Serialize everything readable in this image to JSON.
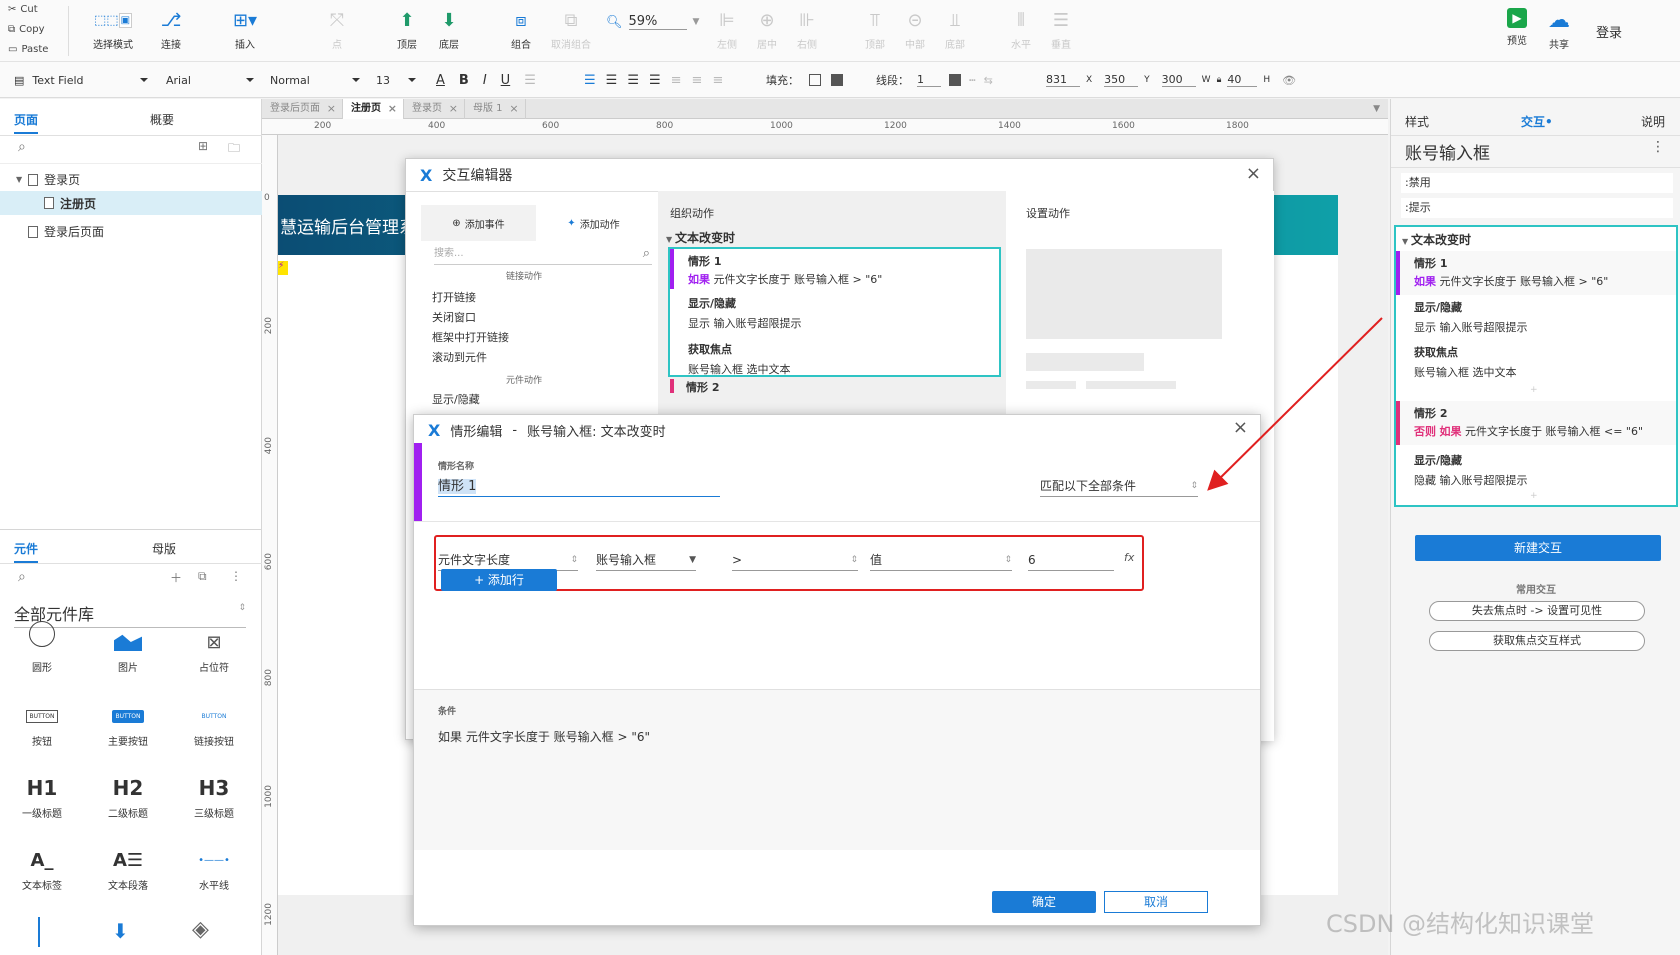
{
  "toolbar": {
    "clipboard": [
      "Cut",
      "Copy",
      "Paste"
    ],
    "tools": [
      {
        "label": "选择模式",
        "icon": "select-mode-icon"
      },
      {
        "label": "连接",
        "icon": "connect-icon"
      },
      {
        "label": "插入",
        "icon": "insert-icon"
      },
      {
        "label": "点",
        "icon": "point-icon"
      },
      {
        "label": "顶层",
        "icon": "bring-front-icon"
      },
      {
        "label": "底层",
        "icon": "send-back-icon"
      },
      {
        "label": "组合",
        "icon": "group-icon"
      },
      {
        "label": "取消组合",
        "icon": "ungroup-icon"
      },
      {
        "label": "左侧",
        "icon": "align-left-icon"
      },
      {
        "label": "居中",
        "icon": "align-center-icon"
      },
      {
        "label": "右侧",
        "icon": "align-right-icon"
      },
      {
        "label": "顶部",
        "icon": "align-top-icon"
      },
      {
        "label": "中部",
        "icon": "align-middle-icon"
      },
      {
        "label": "底部",
        "icon": "align-bottom-icon"
      },
      {
        "label": "水平",
        "icon": "distribute-h-icon"
      },
      {
        "label": "垂直",
        "icon": "distribute-v-icon"
      }
    ],
    "zoom": "59%",
    "preview": "预览",
    "share": "共享",
    "login": "登录"
  },
  "format_bar": {
    "widget_type": "Text Field",
    "font": "Arial",
    "style": "Normal",
    "size": "13",
    "fill_label": "填充：",
    "line_label": "线段：",
    "line_value": "1",
    "x": "831",
    "x_label": "X",
    "y": "350",
    "y_label": "Y",
    "w": "300",
    "w_label": "W",
    "h": "40",
    "h_label": "H"
  },
  "left_panel": {
    "tabs": [
      "页面",
      "概要"
    ],
    "pages": [
      "登录页",
      "注册页",
      "登录后页面"
    ],
    "lib_tabs": [
      "元件",
      "母版"
    ],
    "library": "全部元件库",
    "widgets": [
      {
        "label": "圆形"
      },
      {
        "label": "图片"
      },
      {
        "label": "占位符"
      },
      {
        "label": "按钮"
      },
      {
        "label": "主要按钮"
      },
      {
        "label": "链接按钮"
      },
      {
        "label": "一级标题"
      },
      {
        "label": "二级标题"
      },
      {
        "label": "三级标题"
      },
      {
        "label": "文本标签"
      },
      {
        "label": "文本段落"
      },
      {
        "label": "水平线"
      }
    ],
    "button_text": "BUTTON",
    "h1": "H1",
    "h2": "H2",
    "h3": "H3"
  },
  "page_tabs": [
    "登录后页面",
    "注册页",
    "登录页",
    "母版 1"
  ],
  "ruler_h": [
    "200",
    "400",
    "600",
    "800",
    "1000",
    "1200",
    "1400",
    "1600",
    "1800"
  ],
  "ruler_v": [
    "0",
    "200",
    "400",
    "600",
    "800",
    "1000",
    "1200"
  ],
  "canvas": {
    "banner": "慧运输后台管理系"
  },
  "right_panel": {
    "tabs": [
      "样式",
      "交互",
      "说明"
    ],
    "widget_name": "账号输入框",
    "props": [
      "禁用",
      "提示"
    ],
    "event": "文本改变时",
    "case1": {
      "title": "情形 1",
      "kw": "如果",
      "cond": "元件文字长度于 账号输入框 > \"6\""
    },
    "actions1": [
      {
        "title": "显示/隐藏",
        "detail": "显示 输入账号超限提示"
      },
      {
        "title": "获取焦点",
        "detail": "账号输入框 选中文本"
      }
    ],
    "case2": {
      "title": "情形 2",
      "kw1": "否则",
      "kw2": "如果",
      "cond": "元件文字长度于 账号输入框 <= \"6\""
    },
    "actions2": [
      {
        "title": "显示/隐藏",
        "detail": "隐藏 输入账号超限提示"
      }
    ],
    "new_interaction": "新建交互",
    "common": "常用交互",
    "common_items": [
      "失去焦点时 -> 设置可见性",
      "获取焦点交互样式"
    ]
  },
  "interaction_editor": {
    "title": "交互编辑器",
    "add_event": "添加事件",
    "add_action": "添加动作",
    "search_placeholder": "搜索...",
    "link_group": "链接动作",
    "link_actions": [
      "打开链接",
      "关闭窗口",
      "框架中打开链接",
      "滚动到元件"
    ],
    "widget_group": "元件动作",
    "widget_actions": [
      "显示/隐藏"
    ],
    "organize": "组织动作",
    "event": "文本改变时",
    "case1_title": "情形 1",
    "case1_kw": "如果",
    "case1_cond": "元件文字长度于 账号输入框 > \"6\"",
    "act1_title": "显示/隐藏",
    "act1_detail": "显示 输入账号超限提示",
    "act2_title": "获取焦点",
    "act2_detail": "账号输入框 选中文本",
    "case2_partial": "情形 2",
    "set_action": "设置动作"
  },
  "case_editor": {
    "title": "情形编辑",
    "separator": "-",
    "subtitle": "账号输入框: 文本改变时",
    "name_label": "情形名称",
    "name_value": "情形 1",
    "match": "匹配以下全部条件",
    "cond_fields": [
      "元件文字长度",
      "账号输入框",
      ">",
      "值",
      "6"
    ],
    "fx": "fx",
    "add_row": "+ 添加行",
    "cond_label": "条件",
    "cond_summary": "如果 元件文字长度于 账号输入框 > \"6\"",
    "ok": "确定",
    "cancel": "取消"
  },
  "watermark": "CSDN @结构化知识课堂",
  "colors": {
    "accent": "#1a7bd6",
    "purple": "#a020f0",
    "pink": "#e0307a",
    "teal": "#2ec4c4",
    "red": "#e02020"
  }
}
